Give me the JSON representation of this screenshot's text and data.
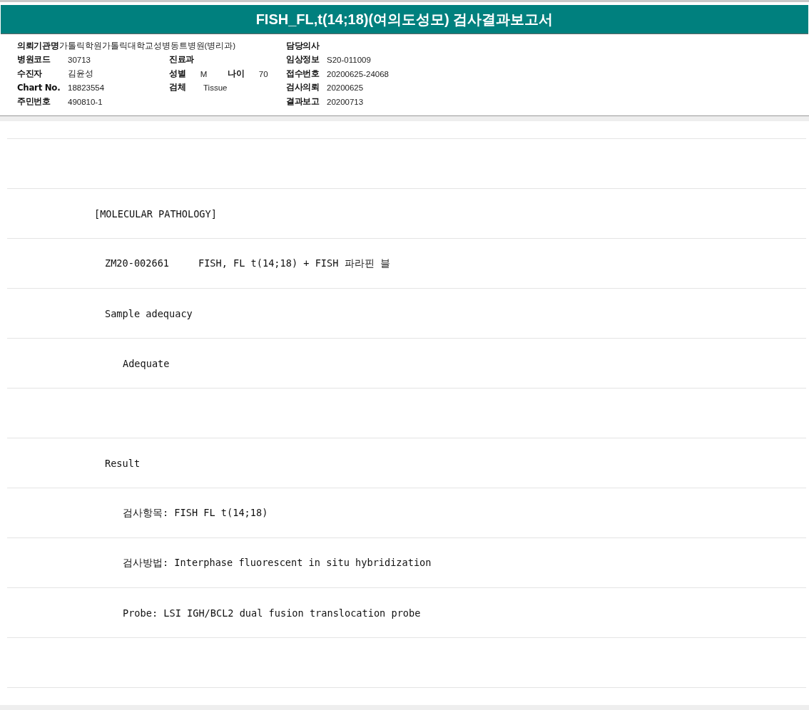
{
  "title": "FISH_FL,t(14;18)(여의도성모) 검사결과보고서",
  "info_rows": [
    {
      "left": [
        {
          "label": "의뢰기관명",
          "value": "가톨릭학원가톨릭대학교성병동트병원(병리과)"
        }
      ],
      "right": [
        {
          "label": "담당의사"
        }
      ]
    },
    {
      "left": [
        {
          "label": "병원코드",
          "value": "30713"
        }
      ],
      "middle": [
        {
          "label": "진료과"
        }
      ],
      "right": [
        {
          "label": "임상정보",
          "value": "S20-011009"
        }
      ]
    },
    {
      "left": [
        {
          "label": "수진자",
          "value": "김윤성"
        }
      ],
      "middle": [
        {
          "label": "성별",
          "value": "M"
        },
        {
          "label": "나이",
          "value": "70"
        }
      ],
      "right": [
        {
          "label": "접수번호",
          "value": "20200625-24068"
        }
      ]
    },
    {
      "left": [
        {
          "label": "Chart No.",
          "value": "18823554"
        }
      ],
      "middle": [
        {
          "label": "검체",
          "value": "Tissue"
        }
      ],
      "right": [
        {
          "label": "검사의뢰",
          "value": "20200625"
        }
      ]
    },
    {
      "left": [
        {
          "label": "주민번호",
          "value": "490810-1"
        }
      ],
      "right": [
        {
          "label": "결과보고",
          "value": "20200713"
        }
      ]
    }
  ],
  "report_lines": [
    {
      "kind": "blank"
    },
    {
      "kind": "section",
      "text": "[MOLECULAR PATHOLOGY]"
    },
    {
      "kind": "entry",
      "text": "ZM20-002661     FISH, FL t(14;18) + FISH 파라핀 블"
    },
    {
      "kind": "entry",
      "text": "Sample adequacy"
    },
    {
      "kind": "detail",
      "text": "Adequate"
    },
    {
      "kind": "blank"
    },
    {
      "kind": "entry",
      "text": "Result"
    },
    {
      "kind": "detail",
      "text": "검사항목: FISH FL t(14;18)"
    },
    {
      "kind": "detail",
      "text": "검사방법: Interphase fluorescent in situ hybridization"
    },
    {
      "kind": "detail",
      "text": "Probe: LSI IGH/BCL2 dual fusion translocation probe"
    },
    {
      "kind": "blank"
    }
  ]
}
